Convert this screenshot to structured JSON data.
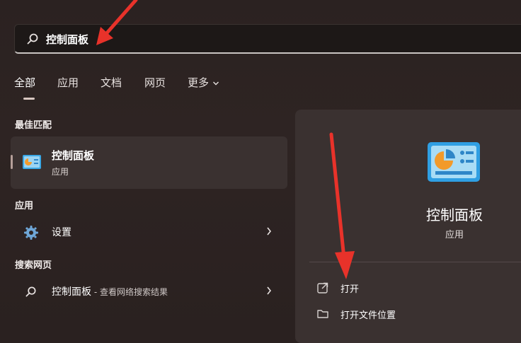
{
  "search": {
    "query": "控制面板"
  },
  "tabs": [
    {
      "label": "全部"
    },
    {
      "label": "应用"
    },
    {
      "label": "文档"
    },
    {
      "label": "网页"
    },
    {
      "label": "更多"
    }
  ],
  "best_match": {
    "heading": "最佳匹配",
    "title": "控制面板",
    "subtitle": "应用"
  },
  "apps": {
    "heading": "应用",
    "items": [
      {
        "label": "设置"
      }
    ]
  },
  "web": {
    "heading": "搜索网页",
    "items": [
      {
        "label": "控制面板",
        "suffix": " - 查看网络搜索结果"
      }
    ]
  },
  "detail": {
    "name": "控制面板",
    "kind": "应用",
    "actions": [
      {
        "label": "打开"
      },
      {
        "label": "打开文件位置"
      }
    ]
  },
  "colors": {
    "annotation_arrow": "#e8322a",
    "accent": "#29a3e0"
  }
}
